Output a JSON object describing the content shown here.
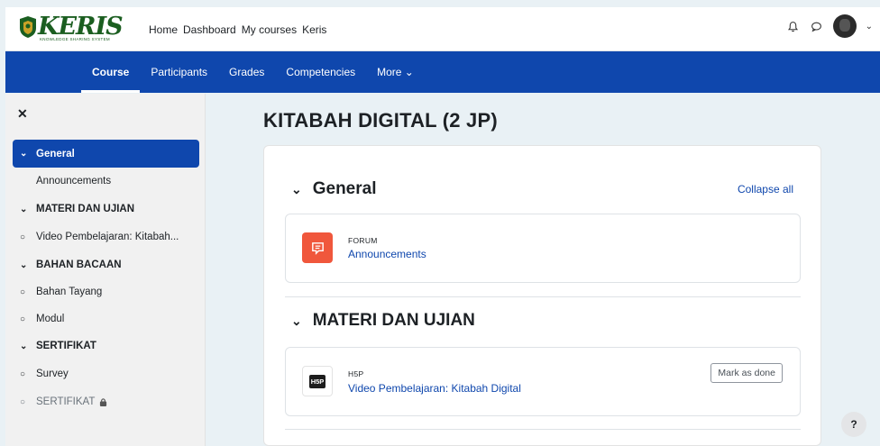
{
  "brand": {
    "name": "KERIS",
    "tagline": "KNOWLEDGE SHARING SYSTEM"
  },
  "topnav": [
    "Home",
    "Dashboard",
    "My courses",
    "Keris"
  ],
  "icons": {
    "notifications": "bell-icon",
    "messages": "chat-icon",
    "user_menu": "chevron-down-icon"
  },
  "secondary_nav": [
    {
      "label": "Course",
      "active": true
    },
    {
      "label": "Participants",
      "active": false
    },
    {
      "label": "Grades",
      "active": false
    },
    {
      "label": "Competencies",
      "active": false
    },
    {
      "label": "More ⌄",
      "active": false
    }
  ],
  "sidebar": {
    "close_glyph": "✕",
    "items": [
      {
        "label": "General",
        "kind": "section",
        "active": true
      },
      {
        "label": "Announcements",
        "kind": "sub"
      },
      {
        "label": "MATERI DAN UJIAN",
        "kind": "section"
      },
      {
        "label": "Video Pembelajaran: Kitabah...",
        "kind": "activity"
      },
      {
        "label": "BAHAN BACAAN",
        "kind": "section"
      },
      {
        "label": "Bahan Tayang",
        "kind": "activity"
      },
      {
        "label": "Modul",
        "kind": "activity"
      },
      {
        "label": "SERTIFIKAT",
        "kind": "section"
      },
      {
        "label": "Survey",
        "kind": "activity"
      },
      {
        "label": "SERTIFIKAT",
        "kind": "activity",
        "locked": true
      }
    ]
  },
  "main": {
    "title": "KITABAH DIGITAL (2 JP)",
    "collapse_all": "Collapse all",
    "sections": [
      {
        "title": "General",
        "activity": {
          "type": "FORUM",
          "name": "Announcements",
          "icon": "forum-icon",
          "color": "#f0573c"
        }
      },
      {
        "title": "MATERI DAN UJIAN",
        "activity": {
          "type": "H5P",
          "name": "Video Pembelajaran: Kitabah Digital",
          "icon_text": "H5P",
          "color": "#1d1d1d",
          "action": "Mark as done"
        }
      }
    ]
  },
  "help": "?",
  "colors": {
    "primary": "#0f47ad",
    "forum": "#f0573c"
  }
}
